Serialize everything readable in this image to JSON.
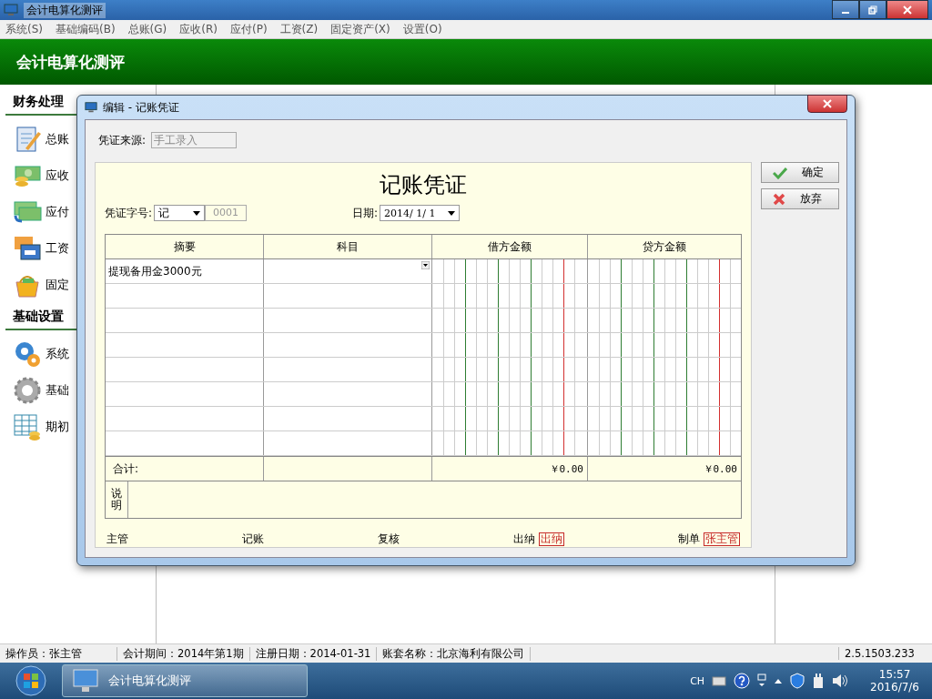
{
  "window": {
    "title": "会计电算化测评",
    "menu": [
      "系统(S)",
      "基础编码(B)",
      "总账(G)",
      "应收(R)",
      "应付(P)",
      "工资(Z)",
      "固定资产(X)",
      "设置(O)"
    ]
  },
  "header": {
    "title": "会计电算化测评"
  },
  "sidebar": {
    "sections": [
      {
        "title": "财务处理",
        "items": [
          {
            "label": "总账",
            "kind": "notebook"
          },
          {
            "label": "应收",
            "kind": "cash-coins"
          },
          {
            "label": "应付",
            "kind": "cash-arrow"
          },
          {
            "label": "工资",
            "kind": "cards"
          },
          {
            "label": "固定",
            "kind": "basket"
          }
        ]
      },
      {
        "title": "基础设置",
        "items": [
          {
            "label": "系统",
            "kind": "gears"
          },
          {
            "label": "基础",
            "kind": "gear"
          },
          {
            "label": "期初",
            "kind": "table-coins"
          }
        ]
      }
    ]
  },
  "dialog": {
    "title": "编辑 - 记账凭证",
    "source_label": "凭证来源:",
    "source_value": "手工录入",
    "source_disabled": true,
    "buttons": [
      {
        "label": "确定",
        "kind": "ok"
      },
      {
        "label": "放弃",
        "kind": "cancel"
      }
    ],
    "voucher": {
      "title": "记账凭证",
      "type_label": "凭证字号:",
      "type_value": "记",
      "number": "0001",
      "date_label": "日期:",
      "date_value": "2014/ 1/ 1",
      "columns": [
        "摘要",
        "科目",
        "借方金额",
        "贷方金额"
      ],
      "rows": [
        {
          "summary": "提现备用金3000元",
          "subject_dropdown": true
        }
      ],
      "total_label": "合计:",
      "debit_total": "￥0.00",
      "credit_total": "￥0.00",
      "note_label": "说明",
      "signatures": [
        {
          "label": "主管"
        },
        {
          "label": "记账"
        },
        {
          "label": "复核"
        },
        {
          "label": "出纳",
          "stamp": "出纳"
        },
        {
          "label": "制单",
          "stamp": "张主管"
        }
      ]
    }
  },
  "status_bar": [
    "操作员：张主管",
    "会计期间：2014年第1期",
    "注册日期：2014-01-31",
    "账套名称：北京海利有限公司",
    "2.5.1503.233"
  ],
  "taskbar": {
    "app": "会计电算化测评",
    "language": "CH",
    "time": "15:57",
    "date": "2016/7/6"
  }
}
